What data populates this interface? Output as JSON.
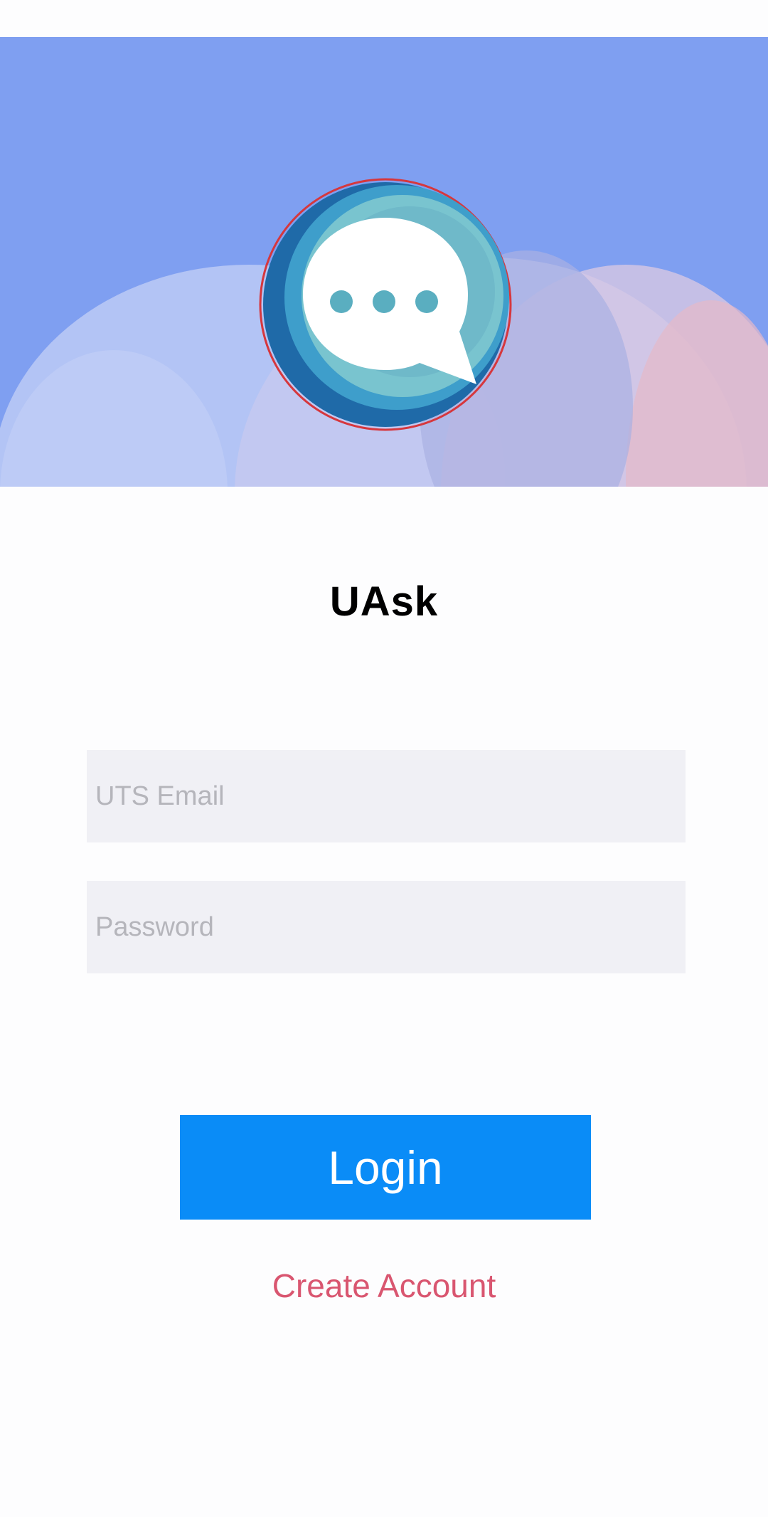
{
  "app": {
    "title": "UAsk"
  },
  "hero": {
    "background_color": "#7f9ff1",
    "logo_icon": "chat-bubble-ellipsis-icon"
  },
  "login_form": {
    "email_placeholder": "UTS Email",
    "email_value": "",
    "password_placeholder": "Password",
    "password_value": "",
    "login_label": "Login",
    "create_account_label": "Create Account"
  },
  "colors": {
    "login_button": "#0a8cf7",
    "create_account_link": "#d95670",
    "input_background": "#f0f0f5"
  }
}
